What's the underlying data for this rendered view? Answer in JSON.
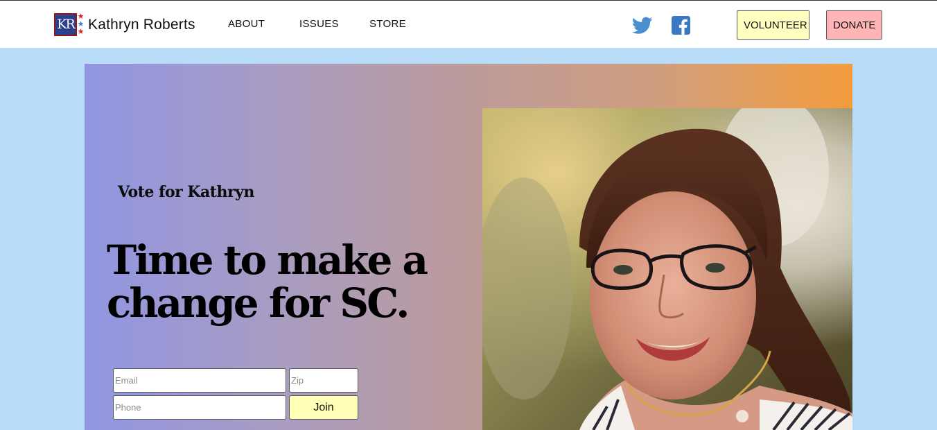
{
  "header": {
    "logo_text": "KR",
    "brand_name": "Kathryn Roberts",
    "nav": [
      {
        "label": "ABOUT"
      },
      {
        "label": "ISSUES"
      },
      {
        "label": "STORE"
      }
    ],
    "social": [
      {
        "name": "twitter-icon",
        "color": "#4a90d0"
      },
      {
        "name": "facebook-icon",
        "color": "#3b78c4"
      }
    ],
    "volunteer_label": "VOLUNTEER",
    "donate_label": "DONATE",
    "colors": {
      "volunteer_bg": "#ffffbf",
      "donate_bg": "#ffb5b5"
    }
  },
  "hero": {
    "kicker": "Vote for Kathryn",
    "headline_line1": "Time to make a",
    "headline_line2": "change for SC.",
    "form": {
      "email_placeholder": "Email",
      "zip_placeholder": "Zip",
      "phone_placeholder": "Phone",
      "join_label": "Join"
    },
    "gradient": [
      "#9196e2",
      "#f39c3c"
    ],
    "photo_alt": "Portrait of Kathryn Roberts smiling"
  },
  "page_bg": "#b8dcf7"
}
